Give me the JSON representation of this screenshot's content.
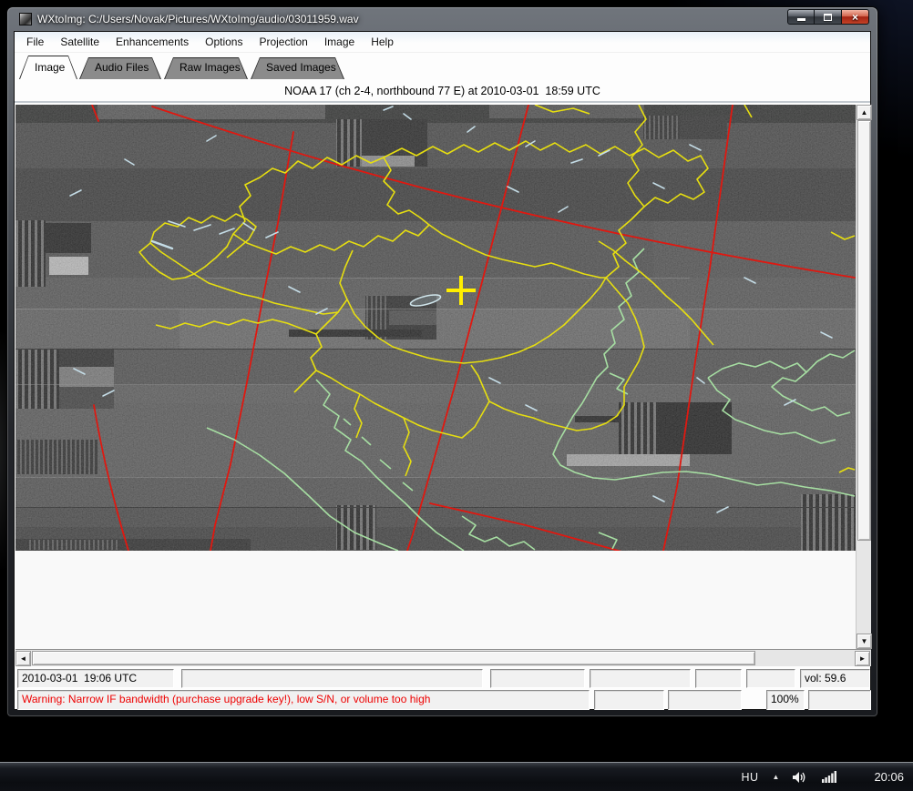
{
  "window": {
    "title": "WXtoImg: C:/Users/Novak/Pictures/WXtoImg/audio/03011959.wav",
    "controls": [
      "minimize-icon",
      "maximize-icon",
      "close-icon"
    ],
    "close_glyph": "×"
  },
  "menu_bar": {
    "items": [
      "File",
      "Satellite",
      "Enhancements",
      "Options",
      "Projection",
      "Image",
      "Help"
    ]
  },
  "tab_bar": {
    "tabs": [
      {
        "label": "Image",
        "active": true
      },
      {
        "label": "Audio Files",
        "active": false
      },
      {
        "label": "Raw Images",
        "active": false
      },
      {
        "label": "Saved Images",
        "active": false
      }
    ]
  },
  "image_panel": {
    "header": "NOAA 17 (ch 2-4, northbound 77 E) at 2010-03-01  18:59 UTC",
    "overlay_colors": {
      "country_borders": "#e6de10",
      "coastlines": "#a6dea2",
      "rivers_lakes": "#c4dce6",
      "lat_lon_grid": "#e01810",
      "cursor_cross": "#ffee00"
    }
  },
  "status_bar": {
    "datetime": "2010-03-01  19:06 UTC",
    "volume": "vol: 59.6"
  },
  "warning_bar": {
    "warning": "Warning: Narrow IF bandwidth (purchase upgrade key!), low S/N, or volume too high",
    "warning_color": "#ee0000",
    "zoom_level": "100%"
  },
  "taskbar": {
    "language": "HU",
    "show_hidden_glyph": "▲",
    "tray_icons": [
      "show-hidden-icon",
      "volume-icon",
      "network-icon"
    ],
    "time": "20:06"
  }
}
